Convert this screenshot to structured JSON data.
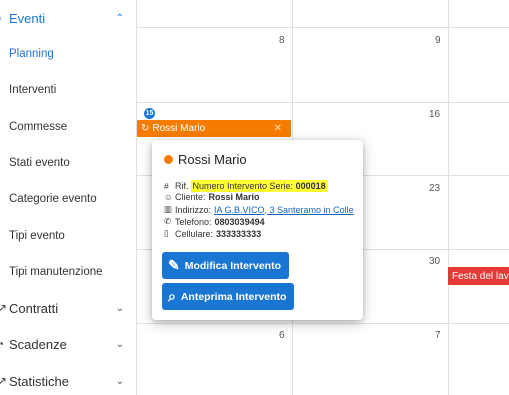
{
  "sidebar": {
    "eventi": "Eventi",
    "items": [
      "Planning",
      "Interventi",
      "Commesse",
      "Stati evento",
      "Categorie evento",
      "Tipi evento",
      "Tipi manutenzione"
    ],
    "contratti": "Contratti",
    "scadenze": "Scadenze",
    "statistiche": "Statistiche"
  },
  "calendar": {
    "days": [
      "8",
      "9",
      "16",
      "23",
      "30",
      "6",
      "7"
    ],
    "event_badge": "15",
    "event_title": "Rossi Mario",
    "holiday": "Festa del lavoro"
  },
  "popover": {
    "title": "Rossi Mario",
    "rif_label": "Rif.",
    "rif_value_prefix": "Numero Intervento Serie:",
    "rif_value": "000018",
    "cliente_label": "Cliente:",
    "cliente_value": "Rossi Mario",
    "indirizzo_label": "Indirizzo:",
    "indirizzo_value": "IA G.B.VICO, 3 Santeramo in Colle",
    "telefono_label": "Telefono:",
    "telefono_value": "0803039494",
    "cellulare_label": "Cellulare:",
    "cellulare_value": "333333333",
    "btn_modifica": "Modifica Intervento",
    "btn_anteprima": "Anteprima Intervento"
  },
  "colors": {
    "accent": "#1976d2",
    "event": "#f57c00",
    "holiday": "#e53935",
    "highlight": "#ffff33"
  }
}
